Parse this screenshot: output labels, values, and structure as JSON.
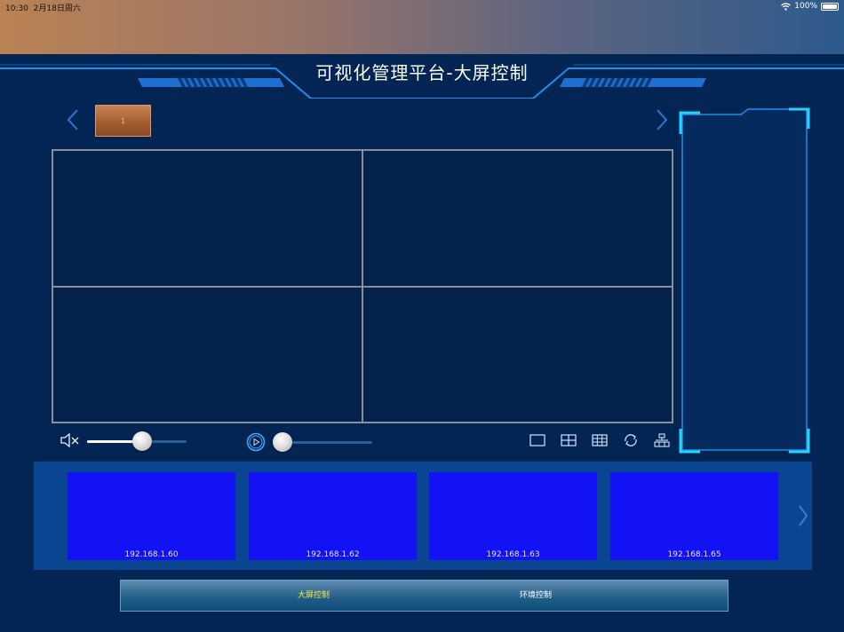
{
  "status_bar": {
    "time": "10:30",
    "date": "2月18日周六",
    "battery": "100%"
  },
  "header": {
    "title": "可视化管理平台-大屏控制"
  },
  "pager": {
    "current_page": "1"
  },
  "cameras": [
    {
      "ip": "192.168.1.60"
    },
    {
      "ip": "192.168.1.62"
    },
    {
      "ip": "192.168.1.63"
    },
    {
      "ip": "192.168.1.65"
    }
  ],
  "volume": {
    "level": 0.55,
    "muted": true
  },
  "playback": {
    "progress": 0.0
  },
  "tabs": [
    {
      "label": "大屏控制",
      "active": true
    },
    {
      "label": "环境控制",
      "active": false
    }
  ],
  "colors": {
    "background": "#032554",
    "accent": "#1f9bff",
    "camera_tile": "#1212f5",
    "active_tab": "#f4e84a"
  },
  "icons": [
    "wifi-icon",
    "battery-icon",
    "chevron-left-icon",
    "chevron-right-icon",
    "mute-icon",
    "play-icon",
    "layout-1-icon",
    "layout-4-icon",
    "layout-9-icon",
    "refresh-icon",
    "settings-icon"
  ]
}
